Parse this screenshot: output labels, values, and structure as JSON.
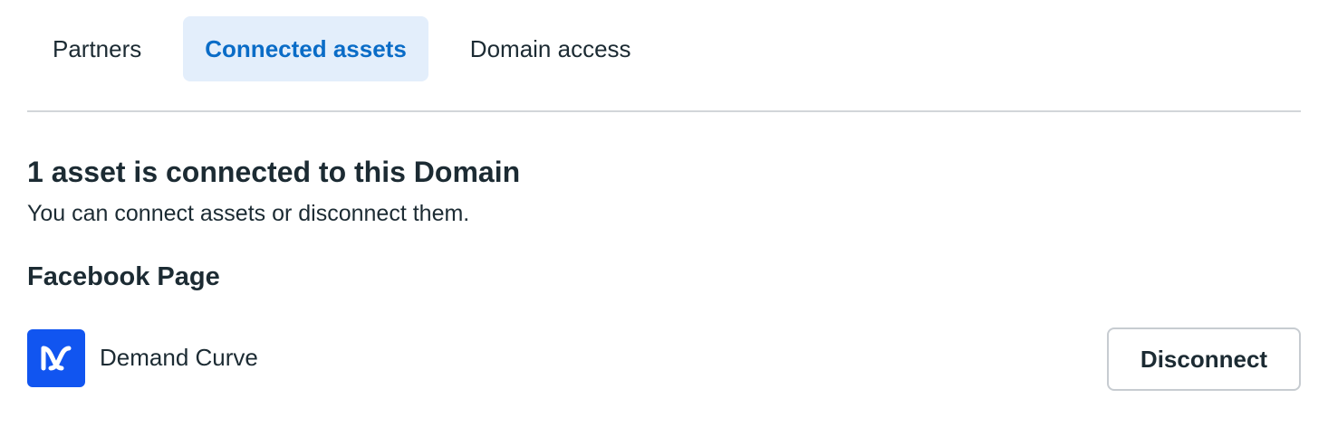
{
  "tabs": [
    {
      "label": "Partners",
      "active": false
    },
    {
      "label": "Connected assets",
      "active": true
    },
    {
      "label": "Domain access",
      "active": false
    }
  ],
  "content": {
    "heading": "1 asset is connected to this Domain",
    "subheading": "You can connect assets or disconnect them.",
    "section_title": "Facebook Page"
  },
  "assets": [
    {
      "name": "Demand Curve",
      "icon": "demand-curve-logo-icon",
      "action_label": "Disconnect"
    }
  ],
  "colors": {
    "accent": "#0a6cc7",
    "active_tab_bg": "#e3eefb",
    "logo_bg": "#1155f0",
    "text": "#1c2b33",
    "divider": "#d2d6d9"
  }
}
